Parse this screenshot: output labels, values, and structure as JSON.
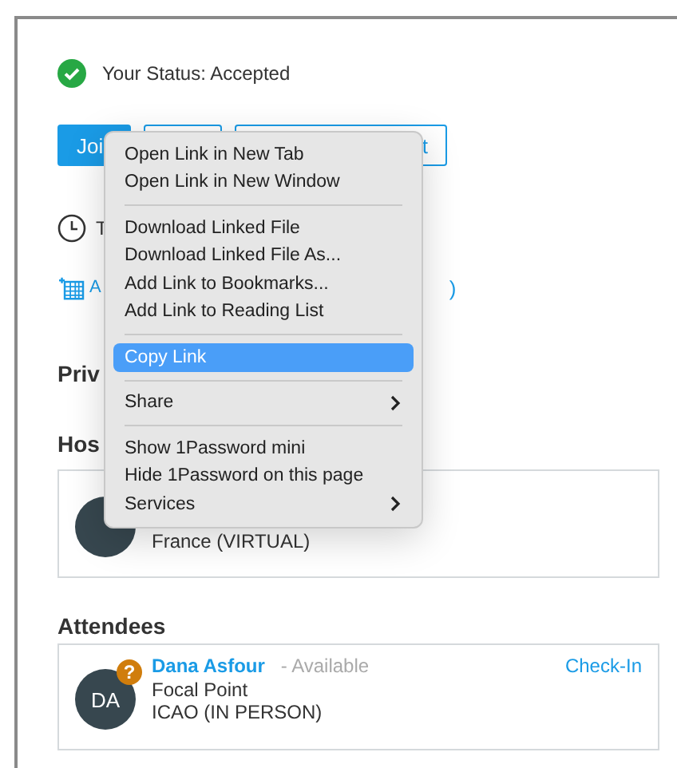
{
  "status": {
    "text": "Your Status: Accepted",
    "accepted": true
  },
  "buttons": [
    {
      "kind": "primary",
      "label": "Joi"
    },
    {
      "kind": "outline"
    },
    {
      "kind": "outline",
      "label": "t"
    }
  ],
  "schedule": {
    "lines": [
      "T"
    ]
  },
  "calendar_link": {
    "start": "A",
    "end": ")"
  },
  "private_heading": "Priv",
  "host": {
    "heading": "Hos",
    "detail": "France (VIRTUAL)"
  },
  "attendees": {
    "heading": "Attendees",
    "items": [
      {
        "initials": "DA",
        "badge": "?",
        "name": "Dana Asfour",
        "availability": "- Available",
        "role": "Focal Point",
        "organization": "ICAO (IN PERSON)",
        "action": "Check-In"
      }
    ]
  },
  "context_menu": {
    "items": [
      {
        "kind": "item",
        "label": "Open Link in New Tab",
        "selected": false
      },
      {
        "kind": "item",
        "label": "Open Link in New Window",
        "selected": false
      },
      {
        "kind": "separator"
      },
      {
        "kind": "item",
        "label": "Download Linked File",
        "selected": false
      },
      {
        "kind": "item",
        "label": "Download Linked File As...",
        "selected": false
      },
      {
        "kind": "item",
        "label": "Add Link to Bookmarks...",
        "selected": false
      },
      {
        "kind": "item",
        "label": "Add Link to Reading List",
        "selected": false
      },
      {
        "kind": "separator"
      },
      {
        "kind": "item",
        "label": "Copy Link",
        "selected": true
      },
      {
        "kind": "separator"
      },
      {
        "kind": "submenu",
        "label": "Share",
        "selected": false
      },
      {
        "kind": "separator"
      },
      {
        "kind": "item",
        "label": "Show 1Password mini",
        "selected": false
      },
      {
        "kind": "item",
        "label": "Hide 1Password on this page",
        "selected": false
      },
      {
        "kind": "submenu",
        "label": "Services",
        "selected": false
      }
    ]
  }
}
